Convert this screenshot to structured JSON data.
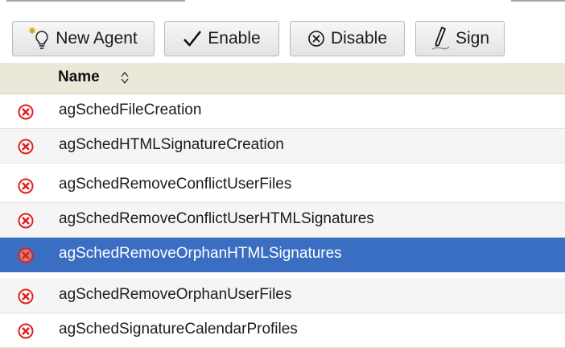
{
  "toolbar": {
    "new_agent": "New Agent",
    "enable": "Enable",
    "disable": "Disable",
    "sign": "Sign"
  },
  "table": {
    "columns": [
      {
        "label": "Name",
        "sortable": true
      }
    ],
    "rows": [
      {
        "name": "agSchedFileCreation",
        "status_icon": "disabled-x-icon",
        "selected": false
      },
      {
        "name": "agSchedHTMLSignatureCreation",
        "status_icon": "disabled-x-icon",
        "selected": false
      },
      {
        "name": "agSchedRemoveConflictUserFiles",
        "status_icon": "disabled-x-icon",
        "selected": false
      },
      {
        "name": "agSchedRemoveConflictUserHTMLSignatures",
        "status_icon": "disabled-x-icon",
        "selected": false
      },
      {
        "name": "agSchedRemoveOrphanHTMLSignatures",
        "status_icon": "disabled-x-icon",
        "selected": true
      },
      {
        "name": "agSchedRemoveOrphanUserFiles",
        "status_icon": "disabled-x-icon",
        "selected": false
      },
      {
        "name": "agSchedSignatureCalendarProfiles",
        "status_icon": "disabled-x-icon",
        "selected": false
      }
    ]
  },
  "colors": {
    "selection": "#3a6ec2",
    "header_bg": "#ebe8d9",
    "disabled_icon": "#e0201e"
  }
}
